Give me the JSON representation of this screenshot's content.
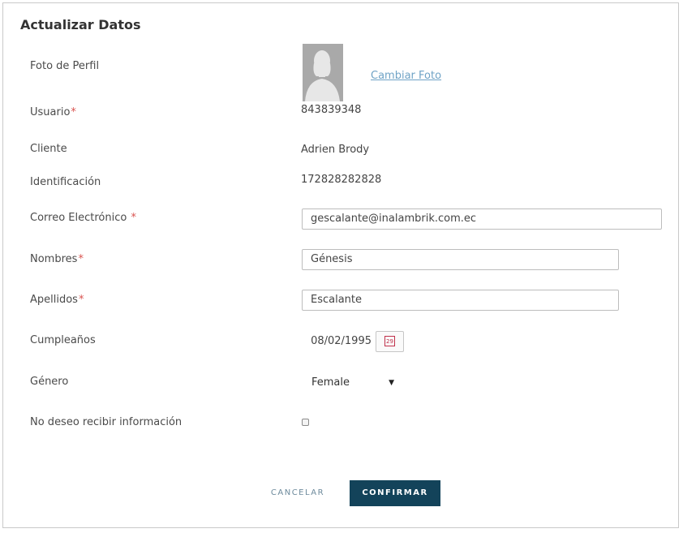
{
  "form": {
    "title": "Actualizar Datos",
    "photo": {
      "label": "Foto de Perfil",
      "change_link": "Cambiar Foto"
    },
    "user": {
      "label": "Usuario",
      "value": "843839348"
    },
    "client": {
      "label": "Cliente",
      "value": "Adrien Brody"
    },
    "identification": {
      "label": "Identificación",
      "value": "172828282828"
    },
    "email": {
      "label": "Correo Electrónico",
      "value": "gescalante@inalambrik.com.ec"
    },
    "first_names": {
      "label": "Nombres",
      "value": "Génesis"
    },
    "last_names": {
      "label": "Apellidos",
      "value": "Escalante"
    },
    "birthday": {
      "label": "Cumpleaños",
      "value": "08/02/1995",
      "calendar_day": "29"
    },
    "gender": {
      "label": "Género",
      "value": "Female"
    },
    "opt_out": {
      "label": "No deseo recibir información",
      "checked": false
    },
    "required_mark": "*",
    "buttons": {
      "cancel": "CANCELAR",
      "confirm": "CONFIRMAR"
    }
  },
  "colors": {
    "primary": "#13435a",
    "link": "#6fa3c6",
    "required": "#d9534f",
    "calendar": "#c0304a"
  }
}
